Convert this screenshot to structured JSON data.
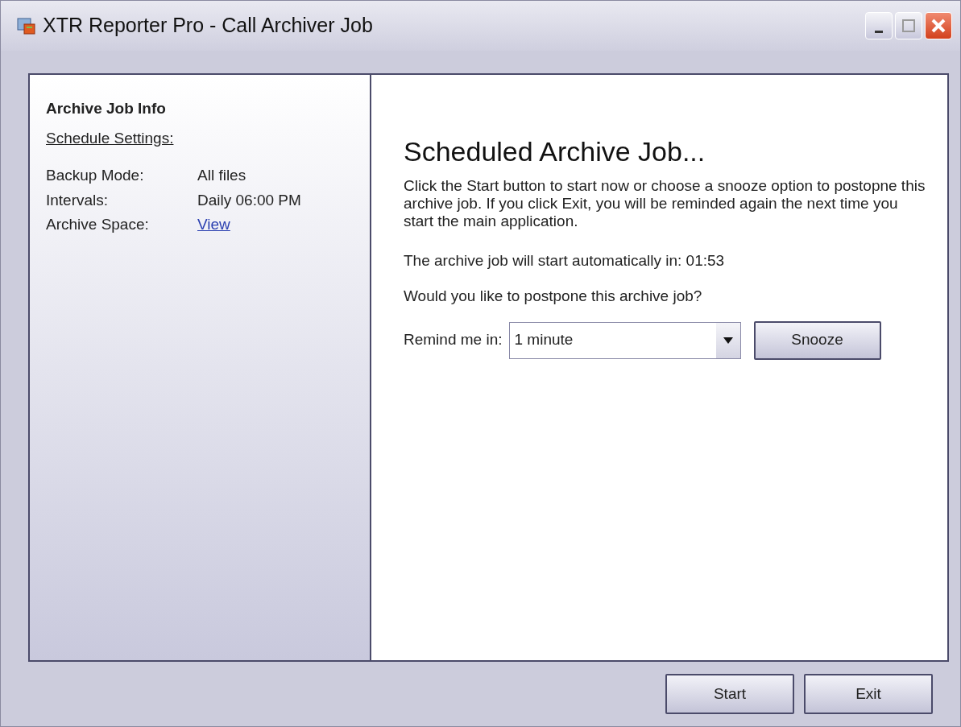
{
  "window": {
    "title": "XTR Reporter Pro - Call Archiver Job"
  },
  "sidebar": {
    "heading": "Archive Job Info",
    "subheading": "Schedule Settings:",
    "rows": [
      {
        "label": "Backup Mode:",
        "value": "All files",
        "kind": "text"
      },
      {
        "label": "Intervals:",
        "value": "Daily 06:00 PM",
        "kind": "text"
      },
      {
        "label": "Archive Space:",
        "value": "View",
        "kind": "link"
      }
    ]
  },
  "main": {
    "title": "Scheduled Archive Job...",
    "description": "Click the Start button to start now or choose a snooze option to postopne this archive job. If you click Exit, you will be reminded again the next time you start the main application.",
    "countdown": "The archive job will start automatically in: 01:53",
    "question": "Would you like to postpone this archive job?",
    "remind_label": "Remind me in:",
    "remind_value": "1 minute",
    "snooze_button": "Snooze"
  },
  "buttons": [
    "Start",
    "Exit"
  ]
}
